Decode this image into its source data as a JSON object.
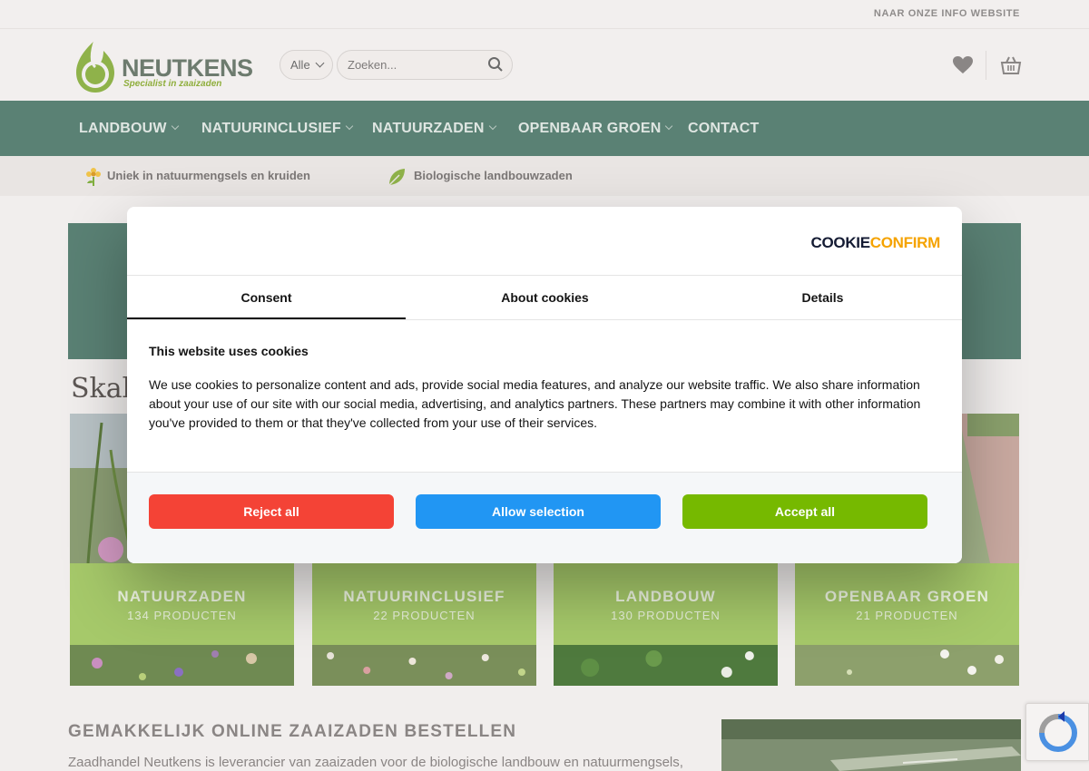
{
  "topbar": {
    "info_link": "NAAR ONZE INFO WEBSITE"
  },
  "header": {
    "logo_brand": "NEUTKENS",
    "logo_tagline": "Specialist in zaaizaden",
    "search_category": "Alle",
    "search_placeholder": "Zoeken..."
  },
  "nav": {
    "items": [
      {
        "label": "LANDBOUW"
      },
      {
        "label": "NATUURINCLUSIEF"
      },
      {
        "label": "NATUURZADEN"
      },
      {
        "label": "OPENBAAR GROEN"
      },
      {
        "label": "CONTACT"
      }
    ]
  },
  "usp": [
    {
      "label": "Uniek in natuurmengsels en kruiden",
      "icon": "flower-icon"
    },
    {
      "label": "Biologische landbouwzaden",
      "icon": "leaf-icon"
    }
  ],
  "main": {
    "partial_heading": "Skal",
    "categories": [
      {
        "title": "NATUURZADEN",
        "count": "134 PRODUCTEN"
      },
      {
        "title": "NATUURINCLUSIEF",
        "count": "22 PRODUCTEN"
      },
      {
        "title": "LANDBOUW",
        "count": "130 PRODUCTEN"
      },
      {
        "title": "OPENBAAR GROEN",
        "count": "21 PRODUCTEN"
      }
    ],
    "section_title": "GEMAKKELIJK ONLINE ZAAIZADEN BESTELLEN",
    "section_text": "Zaadhandel Neutkens is leverancier van zaaizaden voor de biologische landbouw en natuurmengsels,"
  },
  "cookie_dialog": {
    "logo_part1": "COOKIE",
    "logo_part2": "CONFIRM",
    "tabs": [
      {
        "label": "Consent",
        "active": true
      },
      {
        "label": "About cookies",
        "active": false
      },
      {
        "label": "Details",
        "active": false
      }
    ],
    "title": "This website uses cookies",
    "body": "We use cookies to personalize content and ads, provide social media features, and analyze our website traffic. We also share information about your use of our site with our social media, advertising, and analytics partners. These partners may combine it with other information you've provided to them or that they've collected from your use of their services.",
    "buttons": {
      "reject": "Reject all",
      "allow": "Allow selection",
      "accept": "Accept all"
    }
  },
  "colors": {
    "nav_bg": "#5a8174",
    "category_band": "#a6c96a",
    "reject": "#f44336",
    "allow": "#2196f3",
    "accept": "#76b900",
    "cookieconfirm_dark": "#141b33",
    "cookieconfirm_orange": "#f5a300"
  }
}
